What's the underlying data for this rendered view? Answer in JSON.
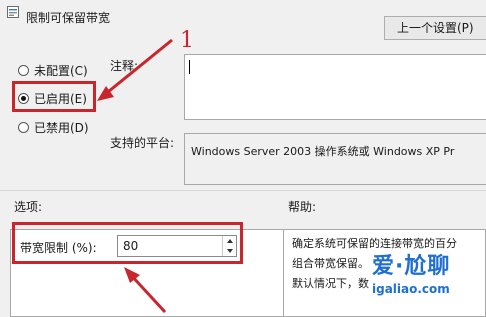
{
  "window": {
    "title": "限制可保留带宽"
  },
  "toolbar": {
    "prev_setting_label": "上一个设置(P)"
  },
  "state_options": [
    {
      "label": "未配置(C)",
      "selected": false
    },
    {
      "label": "已启用(E)",
      "selected": true
    },
    {
      "label": "已禁用(D)",
      "selected": false
    }
  ],
  "comment": {
    "label": "注释:",
    "value": ""
  },
  "platform": {
    "label": "支持的平台:",
    "value": "Windows Server 2003 操作系统或 Windows XP Pr"
  },
  "options": {
    "label": "选项:",
    "bandwidth_label": "带宽限制 (%):",
    "bandwidth_value": "80"
  },
  "help": {
    "label": "帮助:",
    "lines": [
      "确定系统可保留的连接带宽的百分",
      "组合带宽保留。",
      "默认情况下，数"
    ]
  },
  "annotations": {
    "step_number": "1",
    "highlight_color": "#c8262c"
  },
  "watermark": {
    "main": "爱·尬聊",
    "sub": "igaliao.com"
  }
}
